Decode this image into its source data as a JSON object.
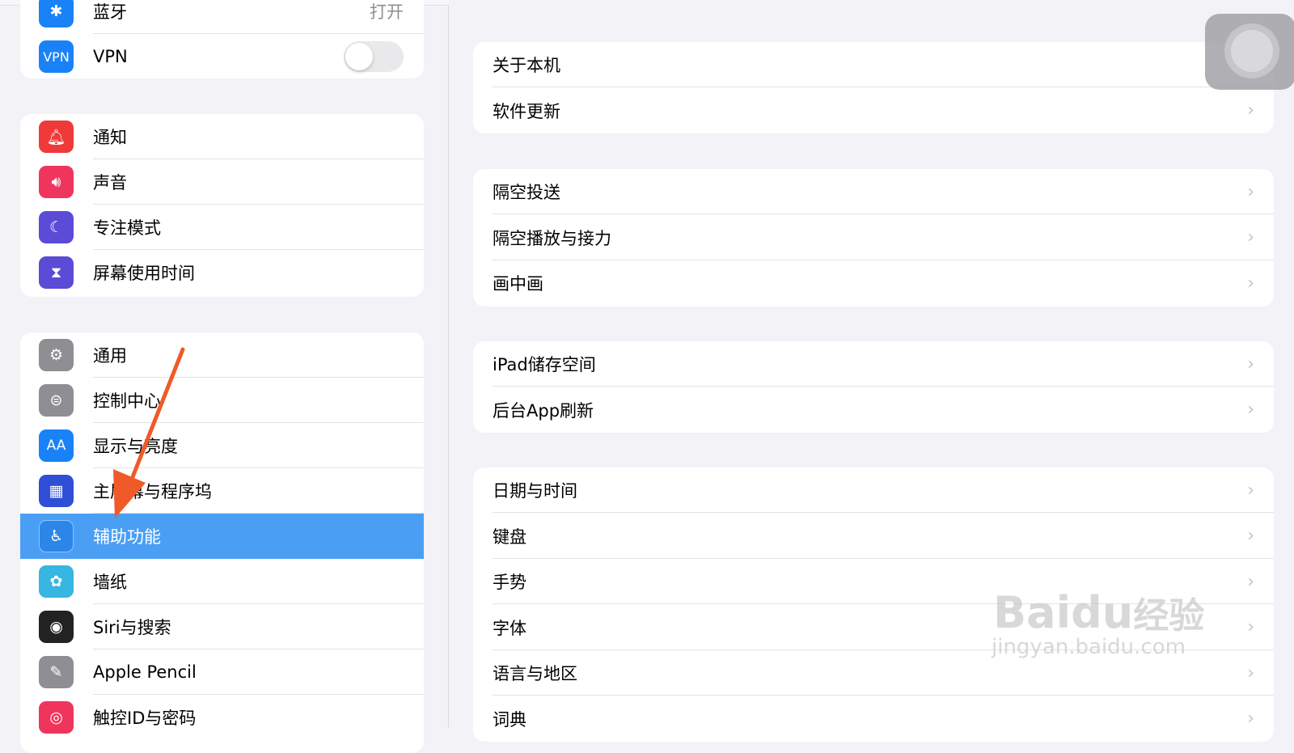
{
  "sidebar": {
    "group1": [
      {
        "label": "蓝牙",
        "value": "打开",
        "icon": "bluetooth-icon",
        "color": "#1a82f7"
      },
      {
        "label": "VPN",
        "toggle": false,
        "icon": "vpn-icon",
        "icon_text": "VPN",
        "color": "#1a82f7"
      }
    ],
    "group2": [
      {
        "label": "通知",
        "icon": "bell-icon",
        "color": "#f03a3a"
      },
      {
        "label": "声音",
        "icon": "speaker-icon",
        "color": "#f0355d"
      },
      {
        "label": "专注模式",
        "icon": "moon-icon",
        "color": "#5b4bd6"
      },
      {
        "label": "屏幕使用时间",
        "icon": "hourglass-icon",
        "color": "#5b4bd6"
      }
    ],
    "group3": [
      {
        "label": "通用",
        "icon": "gear-icon",
        "color": "#8e8e93"
      },
      {
        "label": "控制中心",
        "icon": "switches-icon",
        "color": "#8e8e93"
      },
      {
        "label": "显示与亮度",
        "icon": "text-size-icon",
        "icon_text": "AA",
        "color": "#1a82f7"
      },
      {
        "label": "主屏幕与程序坞",
        "icon": "home-grid-icon",
        "color": "#2f4fd6"
      },
      {
        "label": "辅助功能",
        "icon": "accessibility-icon",
        "color": "#2b86e8",
        "selected": true
      },
      {
        "label": "墙纸",
        "icon": "flower-icon",
        "color": "#36b6e0"
      },
      {
        "label": "Siri与搜索",
        "icon": "siri-icon",
        "color": "#222"
      },
      {
        "label": "Apple Pencil",
        "icon": "pencil-icon",
        "color": "#8e8e93"
      },
      {
        "label": "触控ID与密码",
        "icon": "fingerprint-icon",
        "color": "#f0355d"
      }
    ]
  },
  "main": {
    "groups": [
      [
        "关于本机",
        "软件更新"
      ],
      [
        "隔空投送",
        "隔空播放与接力",
        "画中画"
      ],
      [
        "iPad储存空间",
        "后台App刷新"
      ],
      [
        "日期与时间",
        "键盘",
        "手势",
        "字体",
        "语言与地区",
        "词典"
      ]
    ]
  },
  "annotation": {
    "arrow_color": "#f05a28"
  },
  "watermark": {
    "brand": "Bai",
    "du": "du",
    "jingyan": "经验",
    "url": "jingyan.baidu.com"
  }
}
